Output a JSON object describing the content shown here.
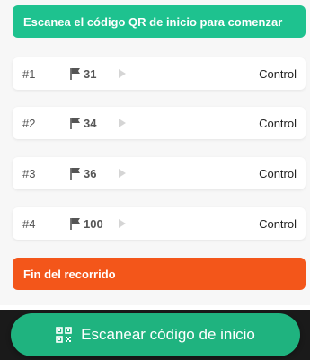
{
  "banner": {
    "text": "Escanea el código QR de inicio para comenzar"
  },
  "rows": [
    {
      "index": "#1",
      "value": "31",
      "action": "Control"
    },
    {
      "index": "#2",
      "value": "34",
      "action": "Control"
    },
    {
      "index": "#3",
      "value": "36",
      "action": "Control"
    },
    {
      "index": "#4",
      "value": "100",
      "action": "Control"
    }
  ],
  "end": {
    "text": "Fin del recorrido"
  },
  "scan_button": {
    "label": "Escanear código de inicio",
    "icon": "qr-code-icon"
  },
  "colors": {
    "accent": "#1ec28f",
    "danger": "#f3561a",
    "button": "#1fb37f"
  }
}
